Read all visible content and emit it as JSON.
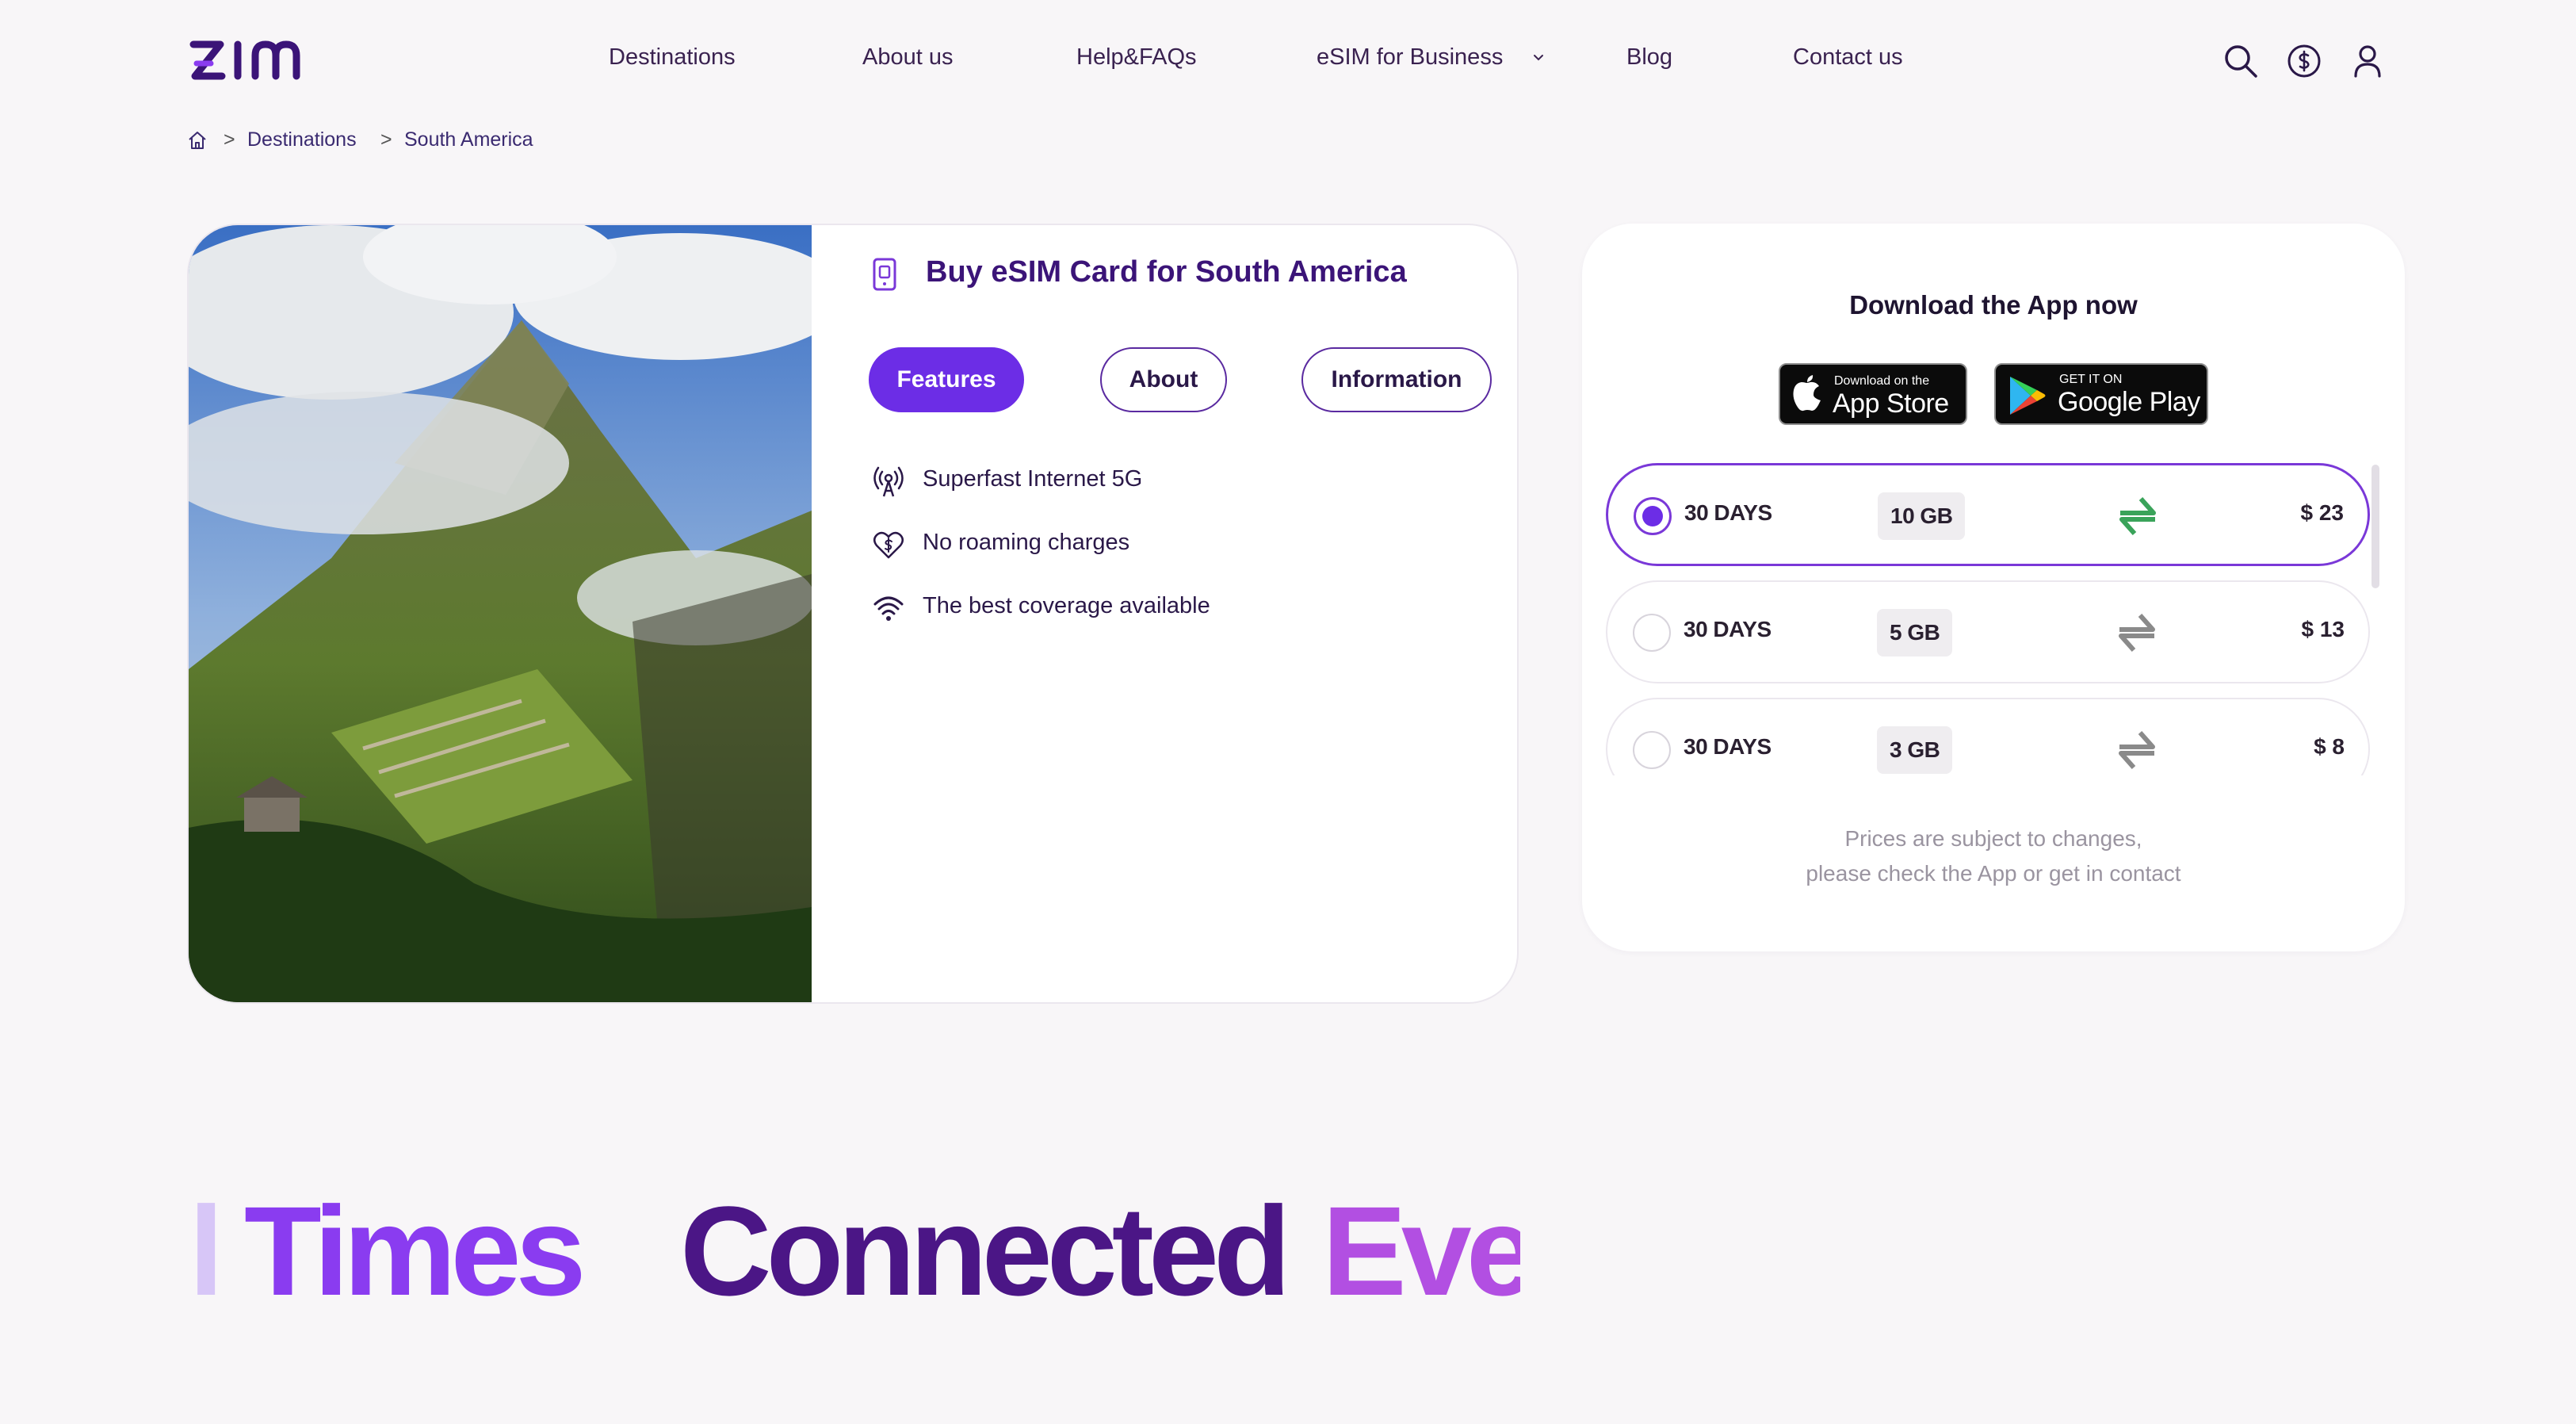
{
  "header": {
    "logo_text": "zim",
    "nav": [
      {
        "label": "Destinations"
      },
      {
        "label": "About us"
      },
      {
        "label": "Help&FAQs"
      },
      {
        "label": "eSIM for Business"
      },
      {
        "label": "Blog"
      },
      {
        "label": "Contact us"
      }
    ],
    "icons": [
      "search-icon",
      "currency-icon",
      "user-icon"
    ]
  },
  "breadcrumb": {
    "home_icon": "home-icon",
    "separator": ">",
    "items": [
      "Destinations",
      "South America"
    ]
  },
  "product": {
    "title": "Buy eSIM Card for South America",
    "tabs": [
      "Features",
      "About",
      "Information"
    ],
    "active_tab": "Features",
    "features": [
      {
        "icon": "antenna-icon",
        "text": "Superfast Internet 5G"
      },
      {
        "icon": "heart-dollar-icon",
        "text": "No roaming charges"
      },
      {
        "icon": "wifi-icon",
        "text": "The best coverage available"
      }
    ]
  },
  "pricing": {
    "download_title": "Download the App now",
    "app_store": {
      "small": "Download on the",
      "big": "App Store"
    },
    "google_play": {
      "small": "GET IT ON",
      "big": "Google Play"
    },
    "plans": [
      {
        "days": "30 DAYS",
        "data": "10 GB",
        "price": "$ 23",
        "selected": true
      },
      {
        "days": "30 DAYS",
        "data": "5 GB",
        "price": "$ 13",
        "selected": false
      },
      {
        "days": "30 DAYS",
        "data": "3 GB",
        "price": "$ 8",
        "selected": false
      }
    ],
    "note_line1": "Prices are subject to changes,",
    "note_line2": "please check the App or get in contact"
  },
  "marquee": {
    "words": [
      "l",
      "Times",
      "Connected",
      "Eve"
    ]
  },
  "colors": {
    "accent": "#6c2de6",
    "title": "#3b1478",
    "selected_border": "#7a38d8",
    "network_selected": "#3aa35a",
    "network_default": "#8a8a8a"
  }
}
